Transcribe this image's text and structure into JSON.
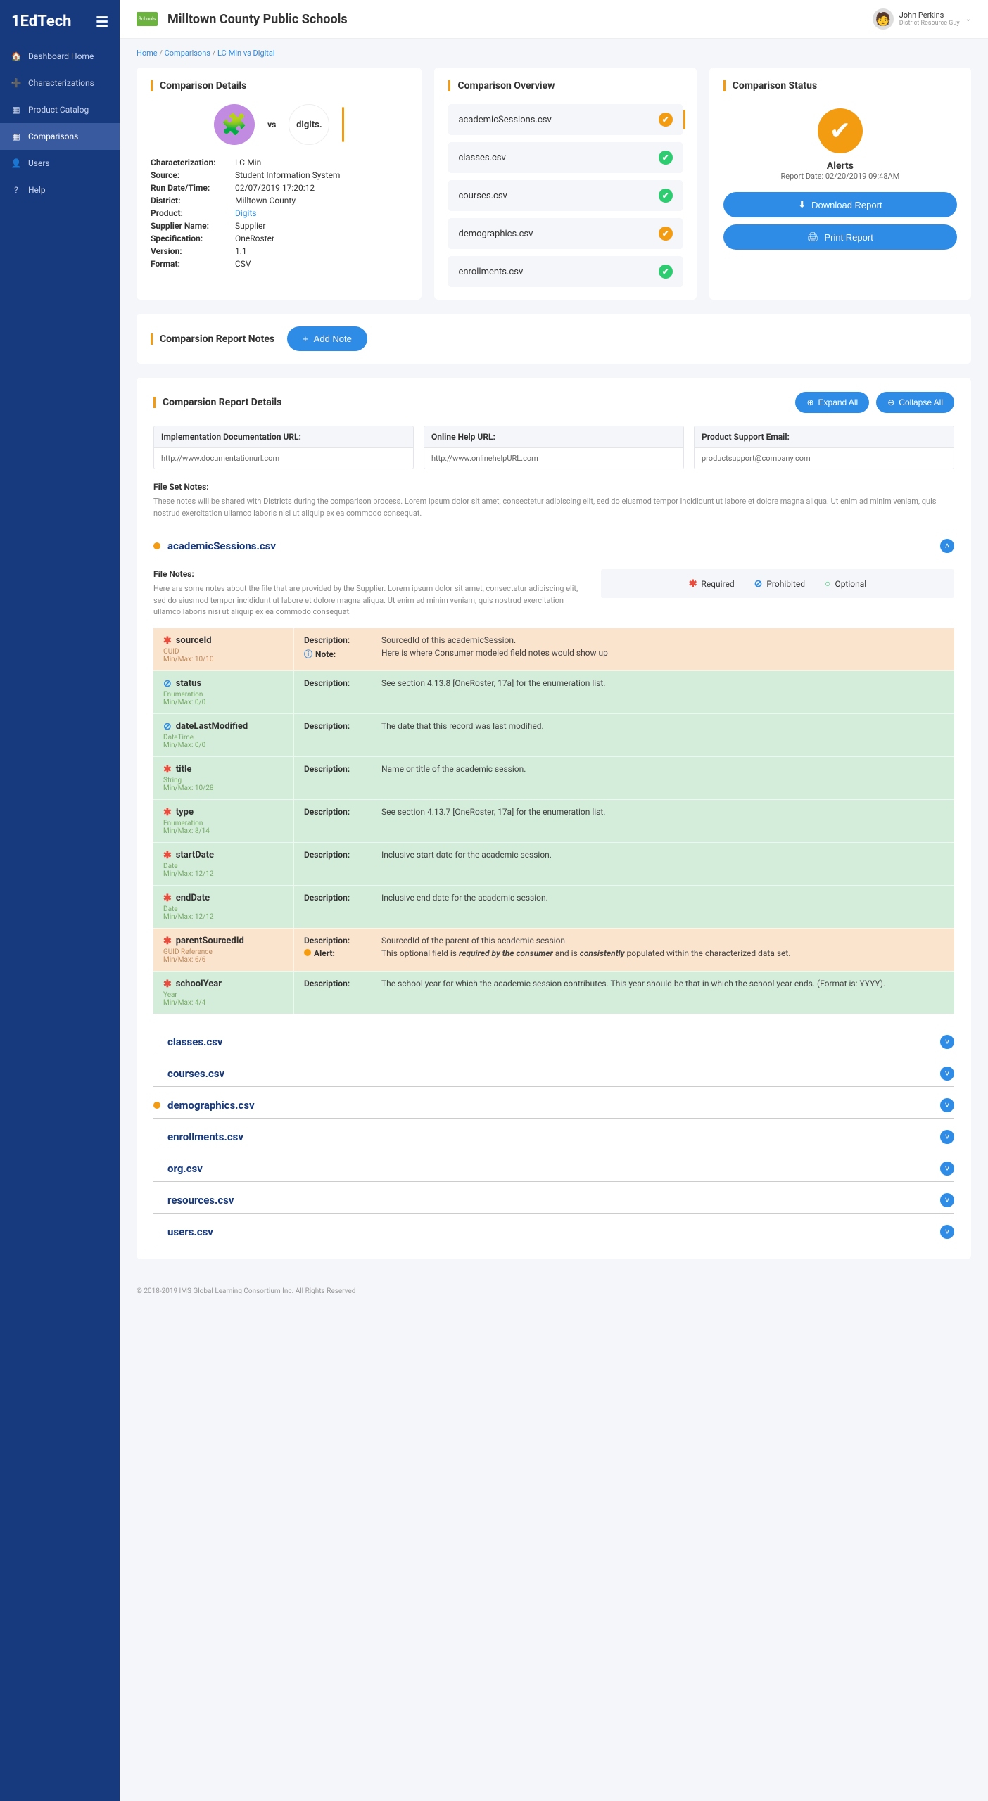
{
  "brand": "1EdTech",
  "sidebar": {
    "items": [
      {
        "icon": "🏠",
        "label": "Dashboard Home"
      },
      {
        "icon": "➕",
        "label": "Characterizations"
      },
      {
        "icon": "▦",
        "label": "Product Catalog"
      },
      {
        "icon": "▦",
        "label": "Comparisons",
        "active": true
      },
      {
        "icon": "👤",
        "label": "Users"
      },
      {
        "icon": "?",
        "label": "Help"
      }
    ]
  },
  "topbar": {
    "org": "Milltown County Public Schools",
    "user_name": "John Perkins",
    "user_role": "District Resource Guy",
    "logo_text": "Schools"
  },
  "breadcrumb": {
    "home": "Home",
    "comparisons": "Comparisons",
    "current": "LC-Min  vs  Digital"
  },
  "details": {
    "title": "Comparison Details",
    "vs": "vs",
    "logo2_text": "digits.",
    "rows": {
      "characterization_l": "Characterization:",
      "characterization_v": "LC-Min",
      "source_l": "Source:",
      "source_v": "Student Information System",
      "run_l": "Run Date/Time:",
      "run_v": "02/07/2019 17:20:12",
      "district_l": "District:",
      "district_v": "Milltown County",
      "product_l": "Product:",
      "product_v": "Digits",
      "supplier_l": "Supplier Name:",
      "supplier_v": "Supplier",
      "spec_l": "Specification:",
      "spec_v": "OneRoster",
      "version_l": "Version:",
      "version_v": "1.1",
      "format_l": "Format:",
      "format_v": "CSV"
    }
  },
  "overview": {
    "title": "Comparison Overview",
    "items": [
      {
        "name": "academicSessions.csv",
        "status": "warn"
      },
      {
        "name": "classes.csv",
        "status": "ok"
      },
      {
        "name": "courses.csv",
        "status": "ok"
      },
      {
        "name": "demographics.csv",
        "status": "warn"
      },
      {
        "name": "enrollments.csv",
        "status": "ok"
      }
    ]
  },
  "status": {
    "title": "Comparison Status",
    "alerts": "Alerts",
    "date": "Report Date: 02/20/2019 09:48AM",
    "download": "Download Report",
    "print": "Print Report"
  },
  "notes": {
    "title": "Comparsion Report Notes",
    "add": "Add Note"
  },
  "reportDetails": {
    "title": "Comparsion Report Details",
    "expand": "Expand All",
    "collapse": "Collapse All",
    "boxes": {
      "doc_l": "Implementation Documentation URL:",
      "doc_v": "http://www.documentationurl.com",
      "help_l": "Online Help URL:",
      "help_v": "http://www.onlinehelpURL.com",
      "support_l": "Product Support Email:",
      "support_v": "productsupport@company.com"
    },
    "fileSetNotes_h": "File Set Notes:",
    "fileSetNotes_t": "These notes will be shared with Districts during the comparison process. Lorem ipsum dolor sit amet, consectetur adipiscing elit, sed do eiusmod tempor incididunt ut labore et dolore magna aliqua. Ut enim ad minim veniam, quis nostrud exercitation ullamco laboris nisi ut  aliquip ex ea commodo consequat."
  },
  "legend": {
    "required": "Required",
    "prohibited": "Prohibited",
    "optional": "Optional"
  },
  "section_academic": {
    "name": "academicSessions.csv",
    "fileNotes_h": "File Notes:",
    "fileNotes_t": "Here are some notes about the file that are provided by the Supplier. Lorem ipsum dolor sit amet, consectetur adipiscing elit, sed do eiusmod tempor incididunt ut labore et dolore magna aliqua. Ut enim ad minim veniam, quis nostrud exercitation ullamco laboris nisi ut aliquip ex ea commodo consequat.",
    "labels": {
      "description": "Description:",
      "note": "Note:",
      "alert": "Alert:",
      "minmax_prefix": "Min/Max: "
    },
    "fields": [
      {
        "name": "sourceId",
        "sym": "req",
        "cls": "req-warn",
        "type": "GUID",
        "minmax": "10/10",
        "desc": "SourcedId of this academicSession.",
        "extra_kind": "note",
        "extra": "Here is where Consumer modeled field notes would show up"
      },
      {
        "name": "status",
        "sym": "pro",
        "cls": "ok",
        "type": "Enumeration",
        "minmax": "0/0",
        "desc": "See section 4.13.8 [OneRoster, 17a] for the enumeration list."
      },
      {
        "name": "dateLastModified",
        "sym": "pro",
        "cls": "ok",
        "type": "DateTime",
        "minmax": "0/0",
        "desc": "The date that this record was last modified."
      },
      {
        "name": "title",
        "sym": "req",
        "cls": "ok",
        "type": "String",
        "minmax": "10/28",
        "desc": "Name or title of the academic session."
      },
      {
        "name": "type",
        "sym": "req",
        "cls": "ok",
        "type": "Enumeration",
        "minmax": "8/14",
        "desc": "See section 4.13.7 [OneRoster, 17a] for the enumeration list."
      },
      {
        "name": "startDate",
        "sym": "req",
        "cls": "ok",
        "type": "Date",
        "minmax": "12/12",
        "desc": "Inclusive start date for the academic session."
      },
      {
        "name": "endDate",
        "sym": "req",
        "cls": "ok",
        "type": "Date",
        "minmax": "12/12",
        "desc": "Inclusive end date for the academic session."
      },
      {
        "name": "parentSourcedId",
        "sym": "req",
        "cls": "req-warn",
        "type": "GUID Reference",
        "minmax": "6/6",
        "desc": "SourcedId of the parent of this academic session",
        "extra_kind": "alert",
        "extra_html": "This optional field is <em>required by the consumer</em> and is <em>consistently</em> populated within the characterized data set."
      },
      {
        "name": "schoolYear",
        "sym": "req",
        "cls": "ok",
        "type": "Year",
        "minmax": "4/4",
        "desc": "The school year for which the academic session contributes. This year should be that in which the school year ends. (Format is: YYYY)."
      }
    ]
  },
  "collapsed_sections": [
    {
      "name": "classes.csv",
      "dot": false
    },
    {
      "name": "courses.csv",
      "dot": false
    },
    {
      "name": "demographics.csv",
      "dot": true
    },
    {
      "name": "enrollments.csv",
      "dot": false
    },
    {
      "name": "org.csv",
      "dot": false
    },
    {
      "name": "resources.csv",
      "dot": false
    },
    {
      "name": "users.csv",
      "dot": false
    }
  ],
  "footer": "© 2018-2019 IMS Global Learning Consortium Inc.  All Rights Reserved"
}
